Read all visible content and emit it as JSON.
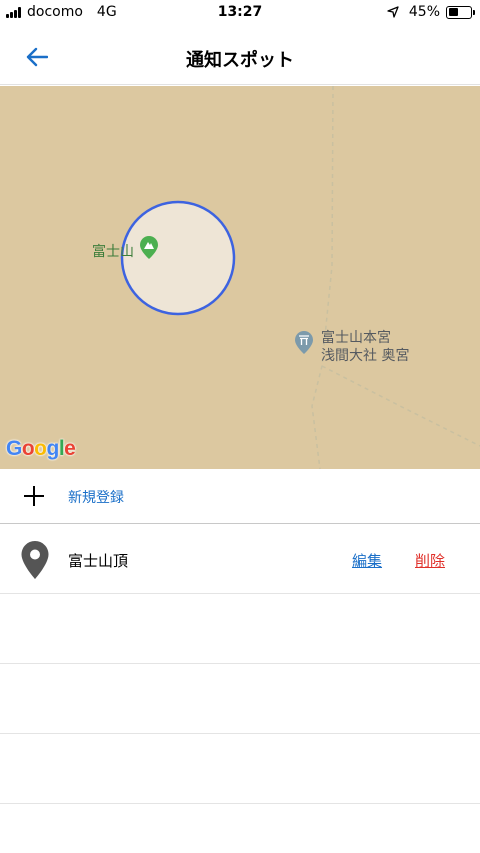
{
  "status_bar": {
    "carrier": "docomo",
    "network": "4G",
    "time": "13:27",
    "battery": "45%",
    "battery_level": 0.45
  },
  "nav": {
    "title": "通知スポット",
    "back_icon": "arrow-left-icon"
  },
  "map": {
    "poi_mountain": "富士山",
    "poi_shrine_line1": "富士山本宮",
    "poi_shrine_line2": "浅間大社 奥宮",
    "attribution": "Google",
    "colors": {
      "land": "#dcc8a0",
      "circle_stroke": "#3d63e0",
      "circle_fill": "#eee5d6",
      "mountain_pin": "#4caf50",
      "shrine_pin": "#7c9aab"
    }
  },
  "add_row": {
    "label": "新規登録"
  },
  "spots": [
    {
      "name": "富士山頂",
      "edit_label": "編集",
      "delete_label": "削除"
    }
  ],
  "colors": {
    "accent": "#1a6fc8",
    "danger": "#e0302a"
  }
}
